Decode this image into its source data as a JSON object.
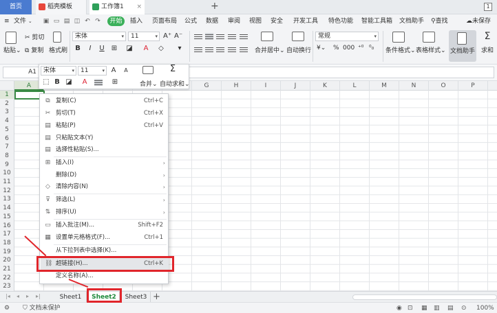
{
  "tabs": {
    "home": "首页",
    "daoke": "稻壳模板",
    "workbook": "工作簿1",
    "close": "×",
    "add": "+",
    "window_count": "1"
  },
  "menubar": {
    "file": "文件",
    "start": "开始",
    "items": [
      "插入",
      "页面布局",
      "公式",
      "数据",
      "审阅",
      "视图",
      "安全",
      "开发工具",
      "特色功能",
      "智能工具箱",
      "文档助手"
    ],
    "search": "查找",
    "unsaved": "未保存"
  },
  "ribbon": {
    "paste": "粘贴",
    "cut": "剪切",
    "copy": "复制",
    "format_painter": "格式刷",
    "font_name": "宋体",
    "font_size": "11",
    "bold": "B",
    "italic": "I",
    "underline": "U",
    "merge_center": "合并居中",
    "auto_wrap": "自动换行",
    "number_format": "常规",
    "currency": "¥",
    "percent": "%",
    "thousands": "000",
    "cond_format": "条件格式",
    "table_style": "表格样式",
    "doc_helper": "文档助手",
    "sum": "求和"
  },
  "formula_bar": {
    "cell_ref": "A1"
  },
  "mini_toolbar": {
    "font_name": "宋体",
    "font_size": "11",
    "grow": "A",
    "shrink": "A",
    "bold": "B",
    "merge": "合并",
    "autosum": "自动求和",
    "sum_symbol": "Σ"
  },
  "grid": {
    "columns": [
      "A",
      "B",
      "C",
      "D",
      "E",
      "F",
      "G",
      "H",
      "I",
      "J",
      "K",
      "L",
      "M",
      "N",
      "O",
      "P"
    ],
    "rows": [
      "1",
      "2",
      "3",
      "4",
      "5",
      "6",
      "7",
      "8",
      "9",
      "10",
      "11",
      "12",
      "13",
      "14",
      "15",
      "16",
      "17",
      "18",
      "19",
      "20",
      "21",
      "22",
      "23"
    ]
  },
  "context_menu": {
    "items": [
      {
        "label": "复制(C)",
        "shortcut": "Ctrl+C",
        "icon": "copy-icon"
      },
      {
        "label": "剪切(T)",
        "shortcut": "Ctrl+X",
        "icon": "scissors-icon"
      },
      {
        "label": "粘贴(P)",
        "shortcut": "Ctrl+V",
        "icon": "paste-icon"
      },
      {
        "label": "只粘贴文本(Y)",
        "shortcut": "",
        "icon": "paste-text-icon"
      },
      {
        "label": "选择性粘贴(S)...",
        "shortcut": "",
        "icon": "paste-special-icon"
      },
      {
        "label": "插入(I)",
        "shortcut": "",
        "icon": "insert-icon"
      },
      {
        "label": "删除(D)",
        "shortcut": "",
        "icon": ""
      },
      {
        "label": "清除内容(N)",
        "shortcut": "",
        "icon": "eraser-icon"
      },
      {
        "label": "筛选(L)",
        "shortcut": "",
        "icon": "filter-icon"
      },
      {
        "label": "排序(U)",
        "shortcut": "",
        "icon": "sort-icon"
      },
      {
        "label": "插入批注(M)...",
        "shortcut": "Shift+F2",
        "icon": "comment-icon"
      },
      {
        "label": "设置单元格格式(F)...",
        "shortcut": "Ctrl+1",
        "icon": "format-cells-icon"
      },
      {
        "label": "从下拉列表中选择(K)...",
        "shortcut": "",
        "icon": ""
      },
      {
        "label": "超链接(H)...",
        "shortcut": "Ctrl+K",
        "icon": "link-icon"
      },
      {
        "label": "定义名称(A)...",
        "shortcut": "",
        "icon": ""
      }
    ],
    "submenu_arrow": "›"
  },
  "sheets": [
    "Sheet1",
    "Sheet2",
    "Sheet3"
  ],
  "sheet_add": "+",
  "status": {
    "protection": "文档未保护",
    "zoom": "100%"
  },
  "colors": {
    "accent_green": "#3a8a44",
    "highlight_red": "#e0252b",
    "home_tab_blue": "#4a7bd0"
  }
}
